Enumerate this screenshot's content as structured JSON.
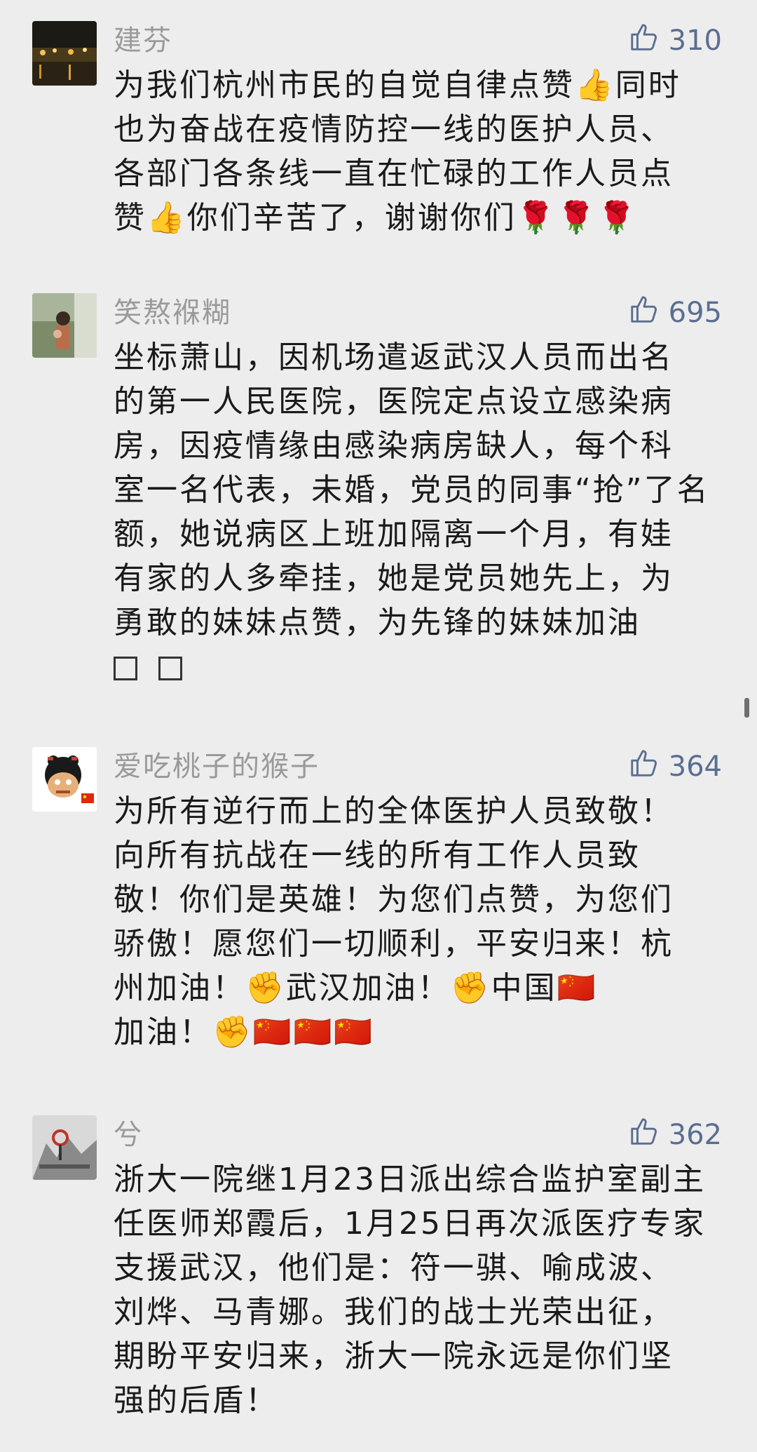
{
  "comments": [
    {
      "user": "建芬",
      "likes": "310",
      "lines": [
        "为我们杭州市民的自觉自律点赞👍同时",
        "也为奋战在疫情防控一线的医护人员、",
        "各部门各条线一直在忙碌的工作人员点",
        "赞👍你们辛苦了，谢谢你们🌹🌹🌹"
      ]
    },
    {
      "user": "笑熬褓糊",
      "likes": "695",
      "lines": [
        "坐标萧山，因机场遣返武汉人员而出名",
        "的第一人民医院，医院定点设立感染病",
        "房，因疫情缘由感染病房缺人，每个科",
        "室一名代表，未婚，党员的同事“抢”了名",
        "额，她说病区上班加隔离一个月，有娃",
        "有家的人多牵挂，她是党员她先上，为",
        "勇敢的妹妹点赞，为先锋的妹妹加油"
      ]
    },
    {
      "user": "爱吃桃子的猴子",
      "likes": "364",
      "lines": [
        "为所有逆行而上的全体医护人员致敬！",
        "向所有抗战在一线的所有工作人员致",
        "敬！你们是英雄！为您们点赞，为您们",
        "骄傲！愿您们一切顺利，平安归来！杭",
        "州加油！✊武汉加油！✊中国🇨🇳",
        "加油！✊🇨🇳🇨🇳🇨🇳"
      ]
    },
    {
      "user": "兮",
      "likes": "362",
      "lines": [
        "浙大一院继1月23日派出综合监护室副主",
        "任医师郑霞后，1月25日再次派医疗专家",
        "支援武汉，他们是：符一骐、喻成波、",
        "刘烨、马青娜。我们的战士光荣出征，",
        "期盼平安归来，浙大一院永远是你们坚",
        "强的后盾！"
      ]
    }
  ],
  "colors": {
    "background": "#EDEDED",
    "username": "#9A9A9A",
    "like_count": "#5A6E91",
    "text": "#1A1A1A"
  },
  "icons": {
    "like": "thumbs-up-outline-icon"
  }
}
